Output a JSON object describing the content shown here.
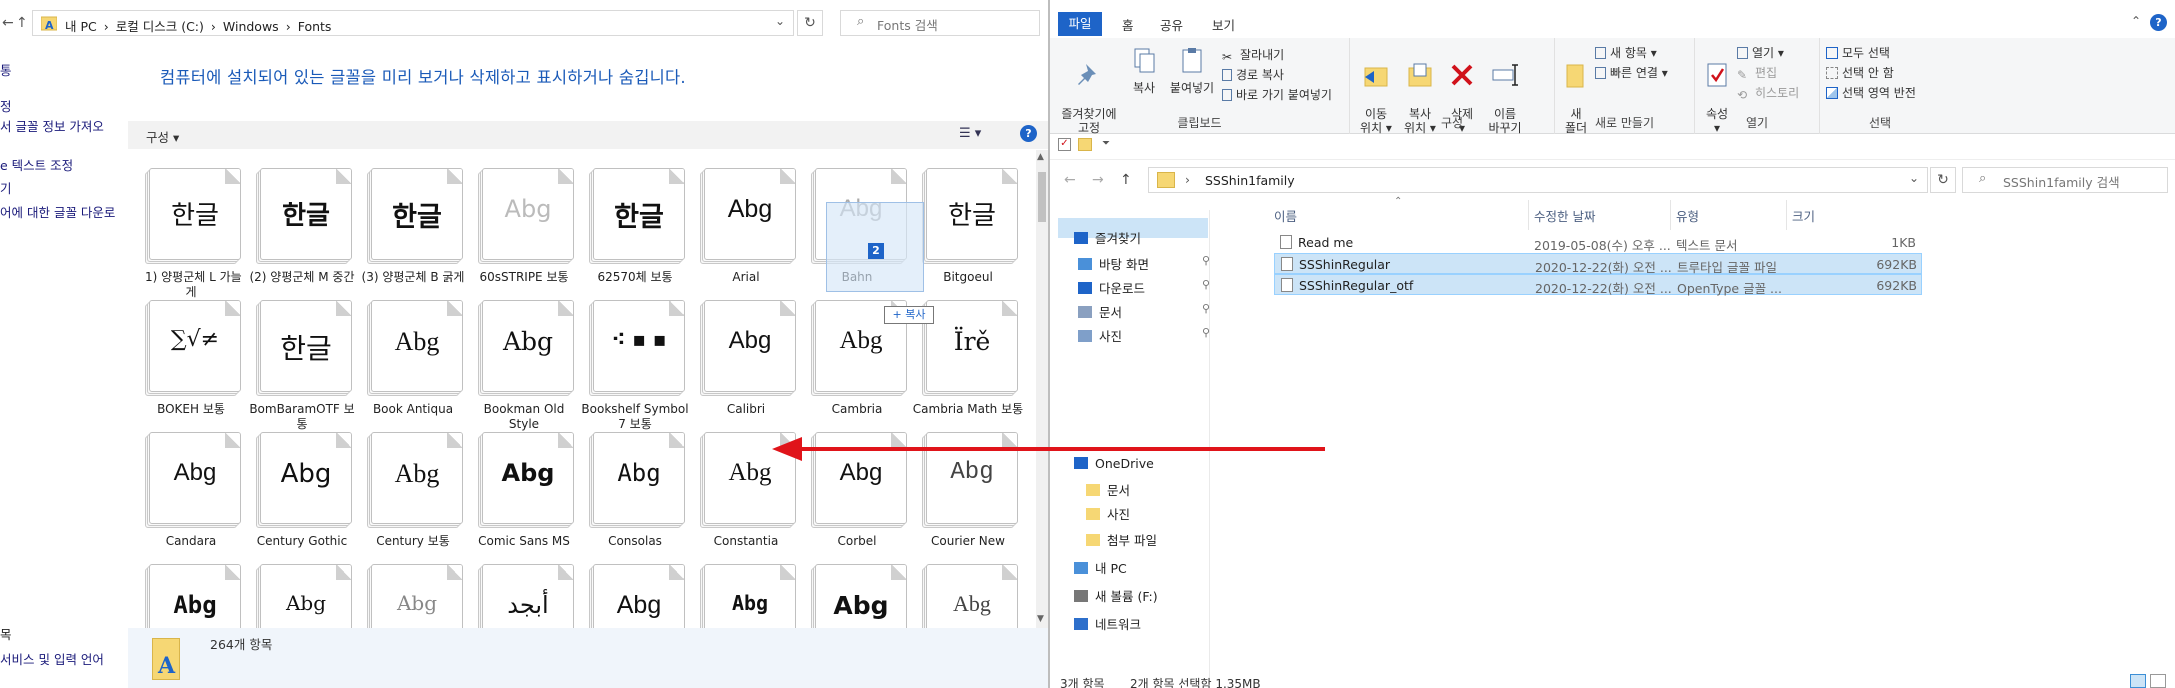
{
  "fonts_window": {
    "address": {
      "crumbs": [
        "내 PC",
        "›",
        "로컬 디스크 (C:)",
        "›",
        "Windows",
        "›",
        "Fonts"
      ],
      "search_placeholder": "Fonts 검색"
    },
    "left_pane": [
      "통",
      "정",
      "서 글꼴 정보 가져오",
      "e 텍스트 조정",
      "기",
      "어에 대한 글꼴 다운로",
      "목",
      "서비스 및 입력 언어"
    ],
    "heading": "컴퓨터에 설치되어 있는 글꼴을 미리 보거나 삭제하고 표시하거나 숨깁니다.",
    "organize_label": "구성 ▾",
    "view_label": "☰ ▾",
    "help_label": "?",
    "fonts": [
      {
        "sample": "한글",
        "label": "(1) 양평군체 L 가늘게"
      },
      {
        "sample": "한글",
        "label": "(2) 양평군체 M 중간"
      },
      {
        "sample": "한글",
        "label": "(3) 양평군체 B 굵게"
      },
      {
        "sample": "Abg",
        "label": "60sSTRIPE 보통"
      },
      {
        "sample": "한글",
        "label": "62570체 보통"
      },
      {
        "sample": "Abg",
        "label": "Arial"
      },
      {
        "sample": "Abg",
        "label": "Bahn"
      },
      {
        "sample": "한글",
        "label": "Bitgoeul"
      },
      {
        "sample": "∑√≠",
        "label": "BOKEH 보통"
      },
      {
        "sample": "한글",
        "label": "BomBaramOTF 보통"
      },
      {
        "sample": "Abg",
        "label": "Book Antiqua"
      },
      {
        "sample": "Abg",
        "label": "Bookman Old Style"
      },
      {
        "sample": "⁖ ▪ ▪",
        "label": "Bookshelf Symbol 7 보통"
      },
      {
        "sample": "Abg",
        "label": "Calibri"
      },
      {
        "sample": "Abg",
        "label": "Cambria"
      },
      {
        "sample": "Ïrě",
        "label": "Cambria Math 보통"
      },
      {
        "sample": "Abg",
        "label": "Candara"
      },
      {
        "sample": "Abg",
        "label": "Century Gothic"
      },
      {
        "sample": "Abg",
        "label": "Century 보통"
      },
      {
        "sample": "Abg",
        "label": "Comic Sans MS"
      },
      {
        "sample": "Abg",
        "label": "Consolas"
      },
      {
        "sample": "Abg",
        "label": "Constantia"
      },
      {
        "sample": "Abg",
        "label": "Corbel"
      },
      {
        "sample": "Abg",
        "label": "Courier New"
      },
      {
        "sample": "Abg",
        "label": ""
      },
      {
        "sample": "Abg",
        "label": ""
      },
      {
        "sample": "Abg",
        "label": ""
      },
      {
        "sample": "أبجد",
        "label": ""
      },
      {
        "sample": "Abg",
        "label": ""
      },
      {
        "sample": "Abg",
        "label": ""
      },
      {
        "sample": "Abg",
        "label": ""
      },
      {
        "sample": "Abg",
        "label": ""
      }
    ],
    "drag_tip": "+ 복사",
    "drag_badge": "2",
    "status_count": "264개 항목"
  },
  "explorer": {
    "tabs": [
      "파일",
      "홈",
      "공유",
      "보기"
    ],
    "ribbon": {
      "clipboard": {
        "name": "클립보드",
        "pin": "즐겨찾기에\n고정",
        "copy": "복사",
        "paste": "붙여넣기",
        "cut": "잘라내기",
        "copy_path": "경로 복사",
        "paste_shortcut": "바로 가기 붙여넣기"
      },
      "organize": {
        "name": "구성",
        "move": "이동\n위치 ▾",
        "copyto": "복사\n위치 ▾",
        "delete": "삭제\n▾",
        "rename": "이름\n바꾸기"
      },
      "new": {
        "name": "새로 만들기",
        "folder": "새\n폴더",
        "new_item": "새 항목 ▾",
        "easy_access": "빠른 연결 ▾"
      },
      "open": {
        "name": "열기",
        "props": "속성\n▾",
        "open": "열기 ▾",
        "edit": "편집",
        "history": "히스토리"
      },
      "select": {
        "name": "선택",
        "all": "모두 선택",
        "none": "선택 안 함",
        "invert": "선택 영역 반전"
      }
    },
    "address": {
      "current": "SSShin1family",
      "search_placeholder": "SSShin1family 검색"
    },
    "nav": [
      {
        "label": "즐겨찾기",
        "pinned": false
      },
      {
        "label": "바탕 화면",
        "pinned": true
      },
      {
        "label": "다운로드",
        "pinned": true
      },
      {
        "label": "문서",
        "pinned": true
      },
      {
        "label": "사진",
        "pinned": true
      },
      {
        "label": "OneDrive",
        "pinned": false
      },
      {
        "label": "문서",
        "pinned": false
      },
      {
        "label": "사진",
        "pinned": false
      },
      {
        "label": "첨부 파일",
        "pinned": false
      },
      {
        "label": "내 PC",
        "pinned": false
      },
      {
        "label": "새 볼륨 (F:)",
        "pinned": false
      },
      {
        "label": "네트워크",
        "pinned": false
      }
    ],
    "columns": [
      "이름",
      "수정한 날짜",
      "유형",
      "크기"
    ],
    "files": [
      {
        "name": "Read me",
        "date": "2019-05-08(수) 오후 ...",
        "type": "텍스트 문서",
        "size": "1KB",
        "selected": false
      },
      {
        "name": "SSShinRegular",
        "date": "2020-12-22(화) 오전 ...",
        "type": "트루타입 글꼴 파일",
        "size": "692KB",
        "selected": true
      },
      {
        "name": "SSShinRegular_otf",
        "date": "2020-12-22(화) 오전 ...",
        "type": "OpenType 글꼴 ...",
        "size": "692KB",
        "selected": true
      }
    ],
    "status": {
      "count": "3개 항목",
      "selected": "2개 항목 선택함 1.35MB"
    }
  },
  "colors": {
    "accent": "#1e64c8",
    "selection": "#cce4f7",
    "arrow": "#e0141a",
    "folder": "#f6d774"
  }
}
